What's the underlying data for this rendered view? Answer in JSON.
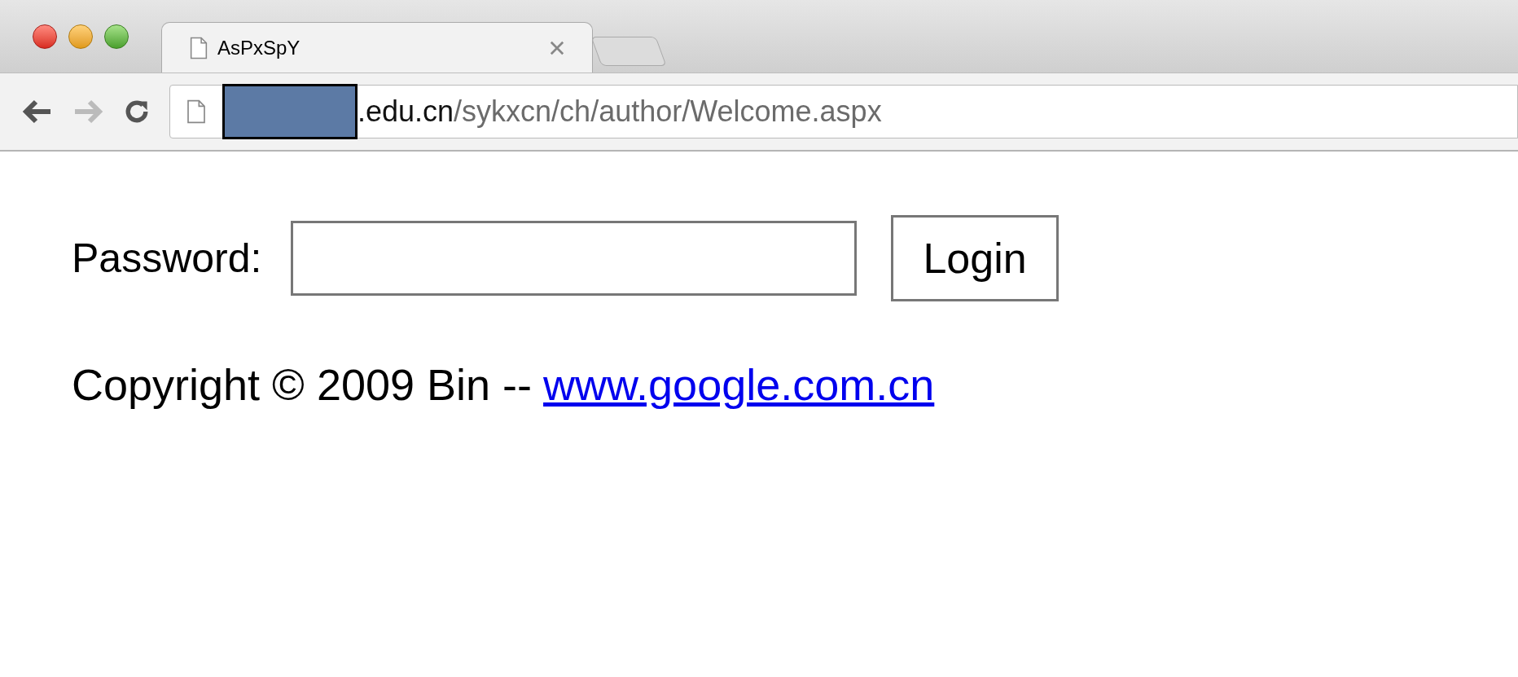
{
  "window": {
    "tabs": [
      {
        "title": "AsPxSpY",
        "selected": true
      }
    ]
  },
  "toolbar": {
    "back_disabled": false,
    "forward_disabled": true,
    "url": {
      "host": ".edu.cn",
      "path": "/sykxcn/ch/author/Welcome.aspx"
    }
  },
  "form": {
    "label": "Password:",
    "button": "Login"
  },
  "footer": {
    "text": "Copyright © 2009 Bin --",
    "link": "www.google.com.cn"
  }
}
